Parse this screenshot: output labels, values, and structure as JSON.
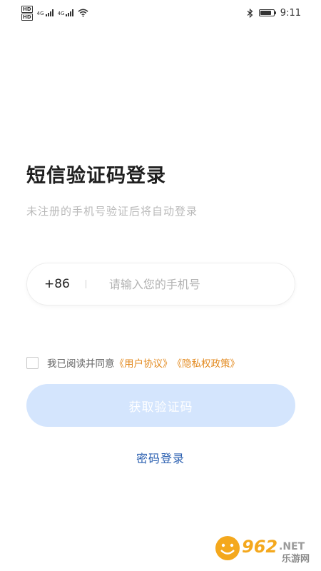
{
  "status_bar": {
    "hd1": "HD",
    "hd2": "HD",
    "net1": "4G",
    "net2": "4G",
    "time": "9:11",
    "battery_level": 0.85
  },
  "page": {
    "title": "短信验证码登录",
    "subtitle": "未注册的手机号验证后将自动登录"
  },
  "phone": {
    "country_code": "+86",
    "value": "",
    "placeholder": "请输入您的手机号"
  },
  "agreement": {
    "prefix": "我已阅读并同意",
    "user_agreement": "《用户协议》",
    "privacy_policy": "《隐私权政策》"
  },
  "buttons": {
    "get_code": "获取验证码",
    "password_login": "密码登录"
  },
  "watermark": {
    "brand_num": "962",
    "brand_suffix": ".NET",
    "brand_cn": "乐游网"
  },
  "colors": {
    "accent_orange": "#e38a1f",
    "link_blue": "#2a5fb0",
    "button_disabled": "#d4e5fd"
  }
}
